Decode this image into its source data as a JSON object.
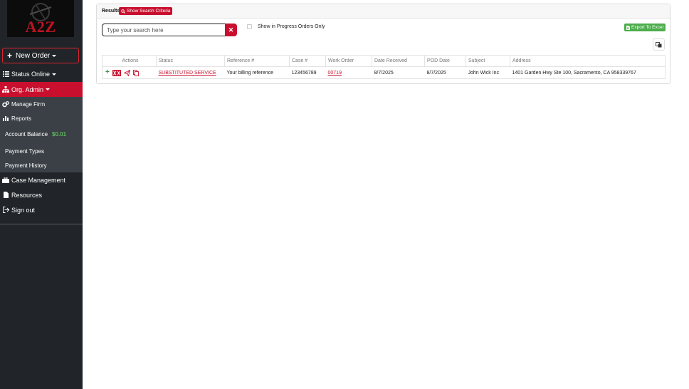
{
  "brand": {
    "logo_text": "A2Z"
  },
  "sidebar": {
    "new_order_label": "New Order",
    "items": [
      {
        "label": "Status Online"
      },
      {
        "label": "Org. Admin"
      },
      {
        "label": "Manage Firm"
      },
      {
        "label": "Reports"
      },
      {
        "label": "Account Balance"
      },
      {
        "label": "Payment Types"
      },
      {
        "label": "Payment History"
      },
      {
        "label": "Case Management"
      },
      {
        "label": "Resources"
      },
      {
        "label": "Sign out"
      }
    ],
    "account_balance_value": "$0.01"
  },
  "results": {
    "label": "Results",
    "show_criteria_label": "Show Search Criteria",
    "search_placeholder": "Type your search here",
    "in_progress_label": "Show in Progress Orders Only",
    "in_progress_checked": false,
    "export_label": "Export To Excel",
    "columns": [
      "Actions",
      "Status",
      "Reference #",
      "Case #",
      "Work Order",
      "Date Received",
      "POD Date",
      "Subject",
      "Address"
    ],
    "rows": [
      {
        "status": "SUBSTITUTED SERVICE",
        "reference": "Your billing reference",
        "case": "123456789",
        "work_order": "00719",
        "date_received": "8/7/2025",
        "pod_date": "8/7/2025",
        "subject": "John Wick Inc",
        "address": "1401 Garden Hwy Ste 100, Sacramento, CA 958339767"
      }
    ]
  },
  "colors": {
    "sidebar_bg": "#212529",
    "accent_red": "#c8102e",
    "success_green": "#4cae4c",
    "balance_green": "#5cb85c"
  }
}
